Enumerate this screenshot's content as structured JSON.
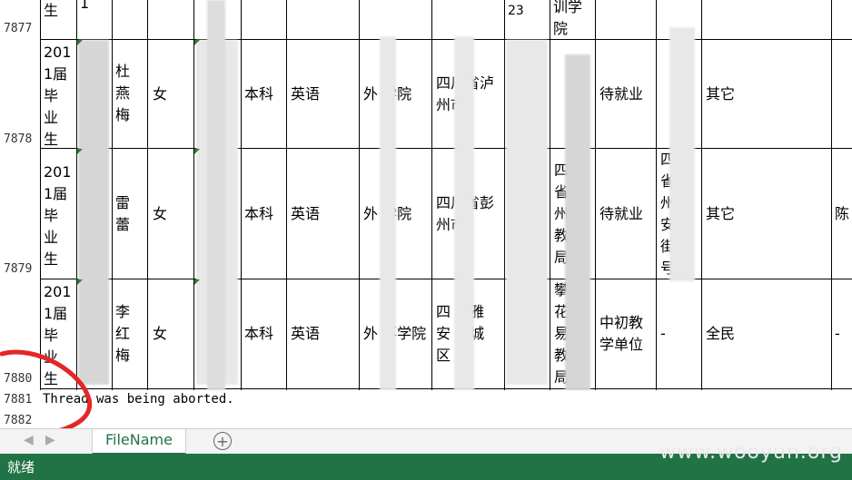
{
  "row_headers": [
    "7877",
    "7878",
    "7879",
    "7880",
    "7881",
    "7882"
  ],
  "rows": [
    {
      "graduate_year": "201\n1届\n毕\n业\n生",
      "name": "杜\n燕\n梅",
      "gender": "女",
      "degree": "本科",
      "major": "英语",
      "college": "外 学院",
      "origin": "四川省泸\n州市",
      "status": "待就业",
      "type": "其它",
      "extra": ""
    },
    {
      "graduate_year": "201\n1届\n毕\n业\n生",
      "name": "雷\n蕾",
      "gender": "女",
      "degree": "本科",
      "major": "英语",
      "college": "外 学院",
      "origin": "四川省彭\n州市",
      "employer_dept": "四\n省\n州\n教\n局",
      "status": "待就业",
      "employer_addr": "四\n省\n州\n安\n街\n号",
      "type": "其它",
      "extra": "陈"
    },
    {
      "graduate_year": "201\n1届\n毕\n业\n生",
      "name": "李\n红\n梅",
      "gender": "女",
      "degree": "本科",
      "major": "英语",
      "college": "外 事学院",
      "origin": "四 省雅\n安 雨城\n区",
      "employer_dept": "攀\n花\n易\n教\n局",
      "status": "中初教\n学单位",
      "employer_addr": "-",
      "type": "全民",
      "extra": "-"
    }
  ],
  "top_partial": {
    "graduate_year": "生",
    "col2": "1",
    "col_phone": "23",
    "col_dept": "训学\n院"
  },
  "message": "Thread was being aborted.",
  "sheet_tab": "FileName",
  "add_sheet_icon": "plus-circle-icon",
  "status_text": "就绪",
  "watermark": "www.wooyun.org",
  "colors": {
    "excel_green": "#217346",
    "annotation_red": "#e32626"
  }
}
